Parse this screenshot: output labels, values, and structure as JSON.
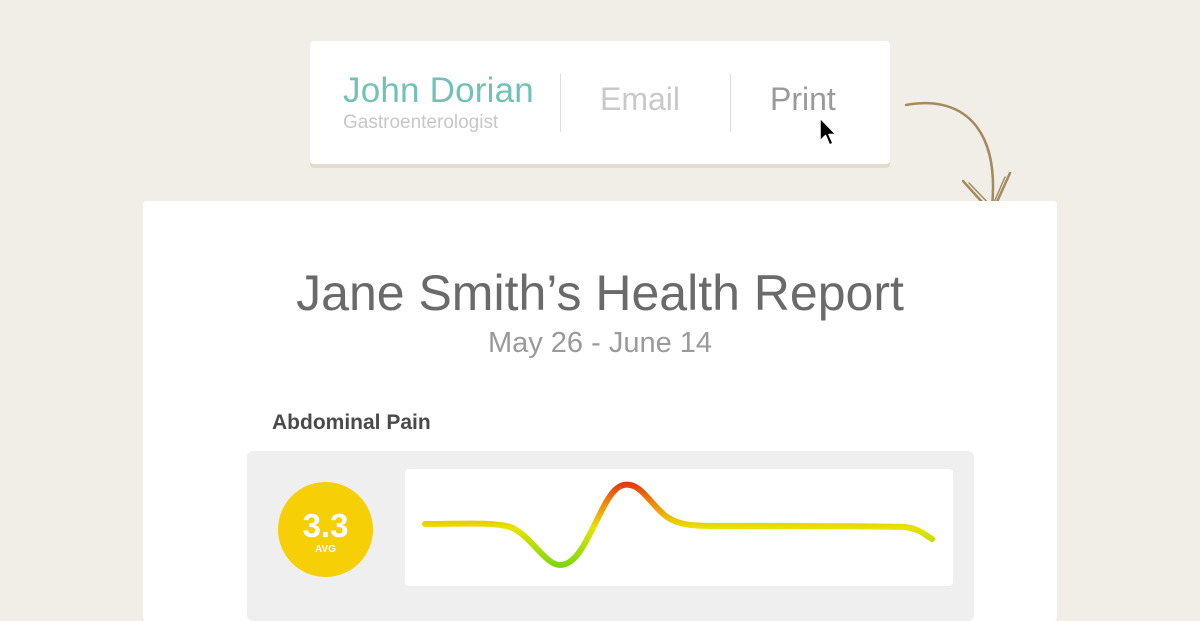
{
  "doctor": {
    "name": "John Dorian",
    "specialty": "Gastroenterologist"
  },
  "actions": {
    "email_label": "Email",
    "print_label": "Print"
  },
  "report": {
    "title": "Jane Smith’s Health Report",
    "date_range": "May 26 - June 14",
    "section_label": "Abdominal Pain",
    "avg_value": "3.3",
    "avg_label": "AVG"
  },
  "colors": {
    "background": "#f1eee8",
    "doctor_name": "#72c1b7",
    "avg_badge": "#f6cf06",
    "arrow": "#a58a5e",
    "trend_low": "#7ed80e",
    "trend_mid": "#e7e305",
    "trend_high": "#dd3a0f"
  },
  "icons": {
    "cursor": "pointer-cursor-icon",
    "arrow": "curved-arrow-icon"
  }
}
